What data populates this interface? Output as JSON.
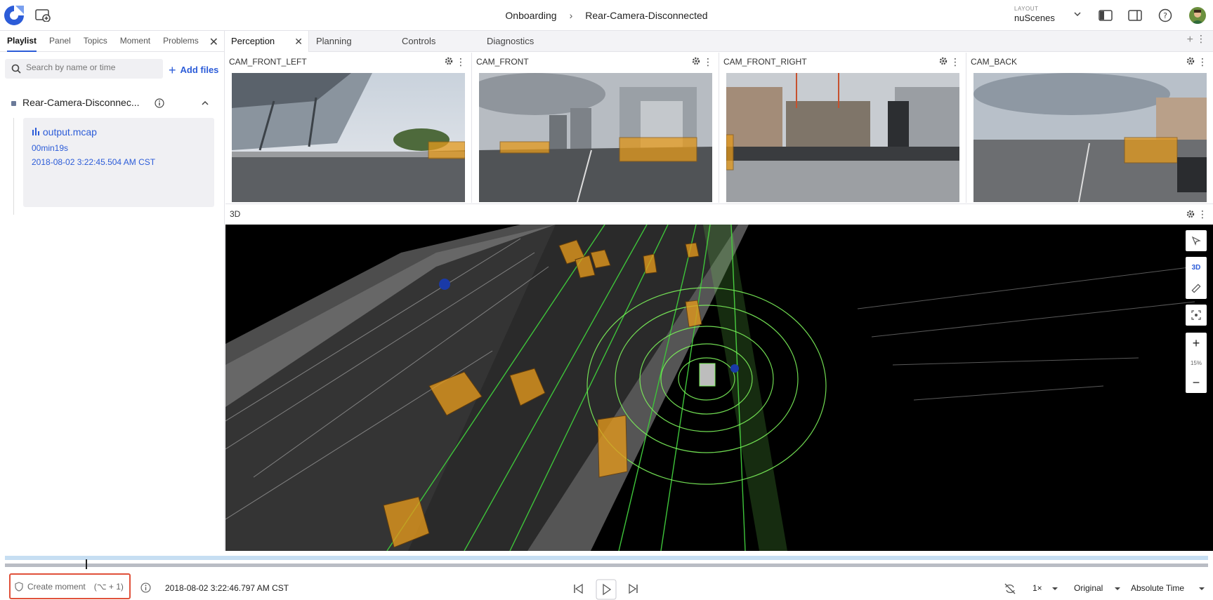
{
  "header": {
    "breadcrumb": [
      "Onboarding",
      "Rear-Camera-Disconnected"
    ],
    "layout_label": "LAYOUT",
    "layout_value": "nuScenes"
  },
  "sidebar": {
    "tabs": [
      "Playlist",
      "Panel",
      "Topics",
      "Moment",
      "Problems"
    ],
    "active_tab": "Playlist",
    "search_placeholder": "Search by name or time",
    "add_files_label": "Add files",
    "source_name": "Rear-Camera-Disconnec...",
    "file": {
      "name": "output.mcap",
      "duration": "00min19s",
      "timestamp": "2018-08-02 3:22:45.504 AM CST"
    }
  },
  "panel_tabs": [
    "Perception",
    "Planning",
    "Controls",
    "Diagnostics"
  ],
  "cameras": [
    "CAM_FRONT_LEFT",
    "CAM_FRONT",
    "CAM_FRONT_RIGHT",
    "CAM_BACK"
  ],
  "panel_3d": {
    "title": "3D",
    "mode_label": "3D",
    "zoom": "15%"
  },
  "timeline": {
    "create_moment_label": "Create moment",
    "create_moment_shortcut": "(⌥ + 1)",
    "current_time": "2018-08-02 3:22:46.797 AM CST",
    "speed": "1×",
    "render_mode": "Original",
    "time_format": "Absolute Time"
  },
  "colors": {
    "accent": "#2c5cd8",
    "highlight_border": "#e0513a",
    "bounding_box": "#e59a1c",
    "lidar": "#7cf25a"
  }
}
